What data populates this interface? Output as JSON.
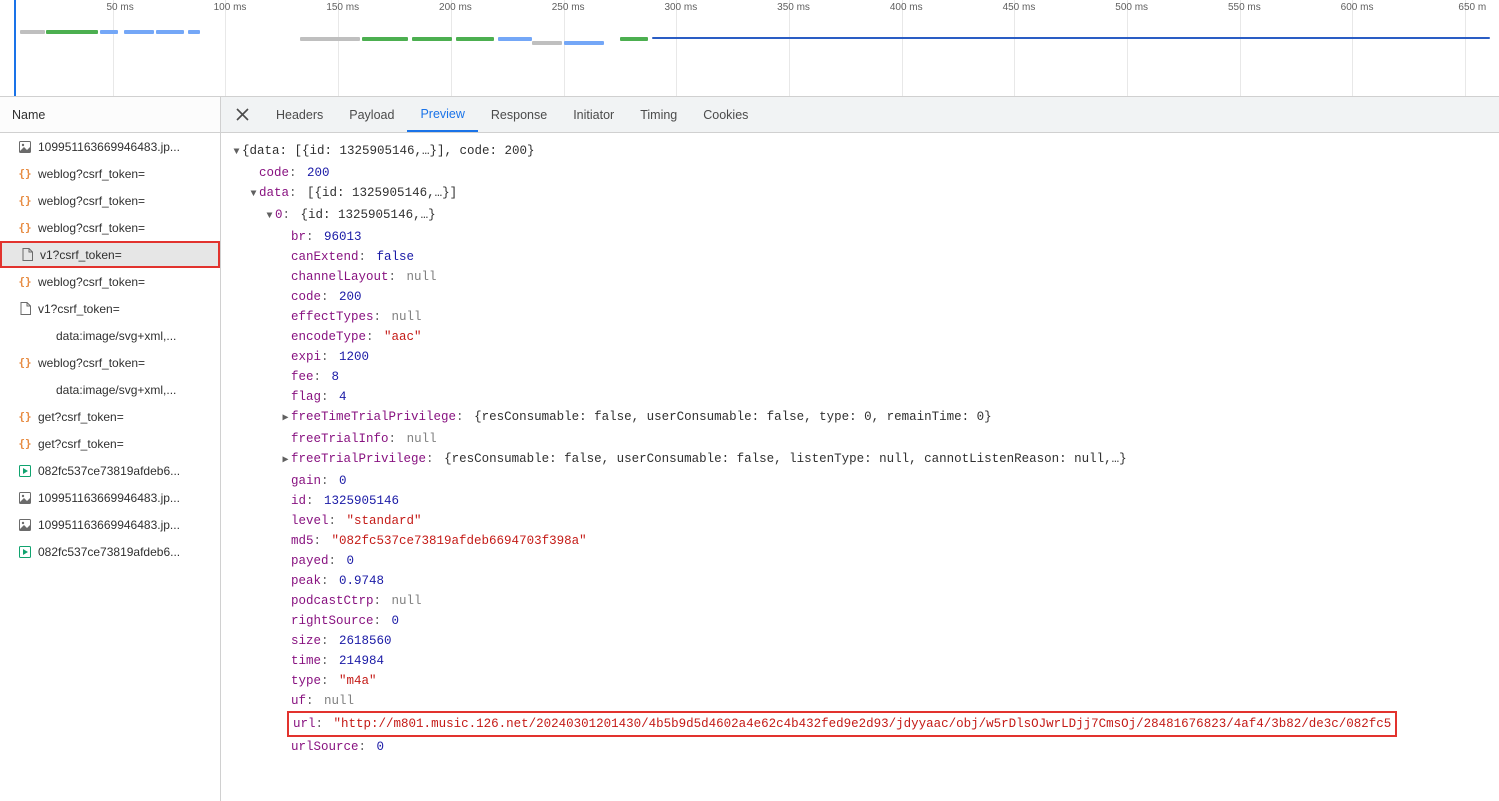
{
  "timeline": {
    "ticks": [
      "50 ms",
      "100 ms",
      "150 ms",
      "200 ms",
      "250 ms",
      "300 ms",
      "350 ms",
      "400 ms",
      "450 ms",
      "500 ms",
      "550 ms",
      "600 ms",
      "650 m"
    ]
  },
  "nameHeader": "Name",
  "requests": [
    {
      "icon": "img",
      "label": "109951163669946483.jp..."
    },
    {
      "icon": "json",
      "label": "weblog?csrf_token="
    },
    {
      "icon": "json",
      "label": "weblog?csrf_token="
    },
    {
      "icon": "json",
      "label": "weblog?csrf_token="
    },
    {
      "icon": "doc",
      "label": "v1?csrf_token=",
      "selected": true
    },
    {
      "icon": "json",
      "label": "weblog?csrf_token="
    },
    {
      "icon": "doc",
      "label": "v1?csrf_token="
    },
    {
      "icon": "none",
      "label": "data:image/svg+xml,...",
      "indent": true
    },
    {
      "icon": "json",
      "label": "weblog?csrf_token="
    },
    {
      "icon": "none",
      "label": "data:image/svg+xml,...",
      "indent": true
    },
    {
      "icon": "json",
      "label": "get?csrf_token="
    },
    {
      "icon": "json",
      "label": "get?csrf_token="
    },
    {
      "icon": "media",
      "label": "082fc537ce73819afdeb6..."
    },
    {
      "icon": "img",
      "label": "109951163669946483.jp..."
    },
    {
      "icon": "img",
      "label": "109951163669946483.jp..."
    },
    {
      "icon": "media",
      "label": "082fc537ce73819afdeb6..."
    }
  ],
  "tabs": [
    "Headers",
    "Payload",
    "Preview",
    "Response",
    "Initiator",
    "Timing",
    "Cookies"
  ],
  "activeTab": "Preview",
  "preview": {
    "rootSummary": "{data: [{id: 1325905146,…}], code: 200}",
    "codeKey": "code",
    "codeVal": "200",
    "dataKey": "data",
    "dataSummary": "[{id: 1325905146,…}]",
    "idx0Key": "0",
    "idx0Summary": "{id: 1325905146,…}",
    "fields": [
      {
        "k": "br",
        "v": "96013",
        "t": "num"
      },
      {
        "k": "canExtend",
        "v": "false",
        "t": "bool"
      },
      {
        "k": "channelLayout",
        "v": "null",
        "t": "null"
      },
      {
        "k": "code",
        "v": "200",
        "t": "num"
      },
      {
        "k": "effectTypes",
        "v": "null",
        "t": "null"
      },
      {
        "k": "encodeType",
        "v": "\"aac\"",
        "t": "str"
      },
      {
        "k": "expi",
        "v": "1200",
        "t": "num"
      },
      {
        "k": "fee",
        "v": "8",
        "t": "num"
      },
      {
        "k": "flag",
        "v": "4",
        "t": "num"
      }
    ],
    "freeTimeKey": "freeTimeTrialPrivilege",
    "freeTimeVal": "{resConsumable: false, userConsumable: false, type: 0, remainTime: 0}",
    "freeTrialInfoKey": "freeTrialInfo",
    "freeTrialInfoVal": "null",
    "freeTrialPrivKey": "freeTrialPrivilege",
    "freeTrialPrivVal": "{resConsumable: false, userConsumable: false, listenType: null, cannotListenReason: null,…}",
    "fields2": [
      {
        "k": "gain",
        "v": "0",
        "t": "num"
      },
      {
        "k": "id",
        "v": "1325905146",
        "t": "num"
      },
      {
        "k": "level",
        "v": "\"standard\"",
        "t": "str"
      },
      {
        "k": "md5",
        "v": "\"082fc537ce73819afdeb6694703f398a\"",
        "t": "str"
      },
      {
        "k": "payed",
        "v": "0",
        "t": "num"
      },
      {
        "k": "peak",
        "v": "0.9748",
        "t": "num"
      },
      {
        "k": "podcastCtrp",
        "v": "null",
        "t": "null"
      },
      {
        "k": "rightSource",
        "v": "0",
        "t": "num"
      },
      {
        "k": "size",
        "v": "2618560",
        "t": "num"
      },
      {
        "k": "time",
        "v": "214984",
        "t": "num"
      },
      {
        "k": "type",
        "v": "\"m4a\"",
        "t": "str"
      },
      {
        "k": "uf",
        "v": "null",
        "t": "null"
      }
    ],
    "urlKey": "url",
    "urlVal": "\"http://m801.music.126.net/20240301201430/4b5b9d5d4602a4e62c4b432fed9e2d93/jdyyaac/obj/w5rDlsOJwrLDjj7CmsOj/28481676823/4af4/3b82/de3c/082fc5",
    "urlSourceKey": "urlSource",
    "urlSourceVal": "0"
  }
}
